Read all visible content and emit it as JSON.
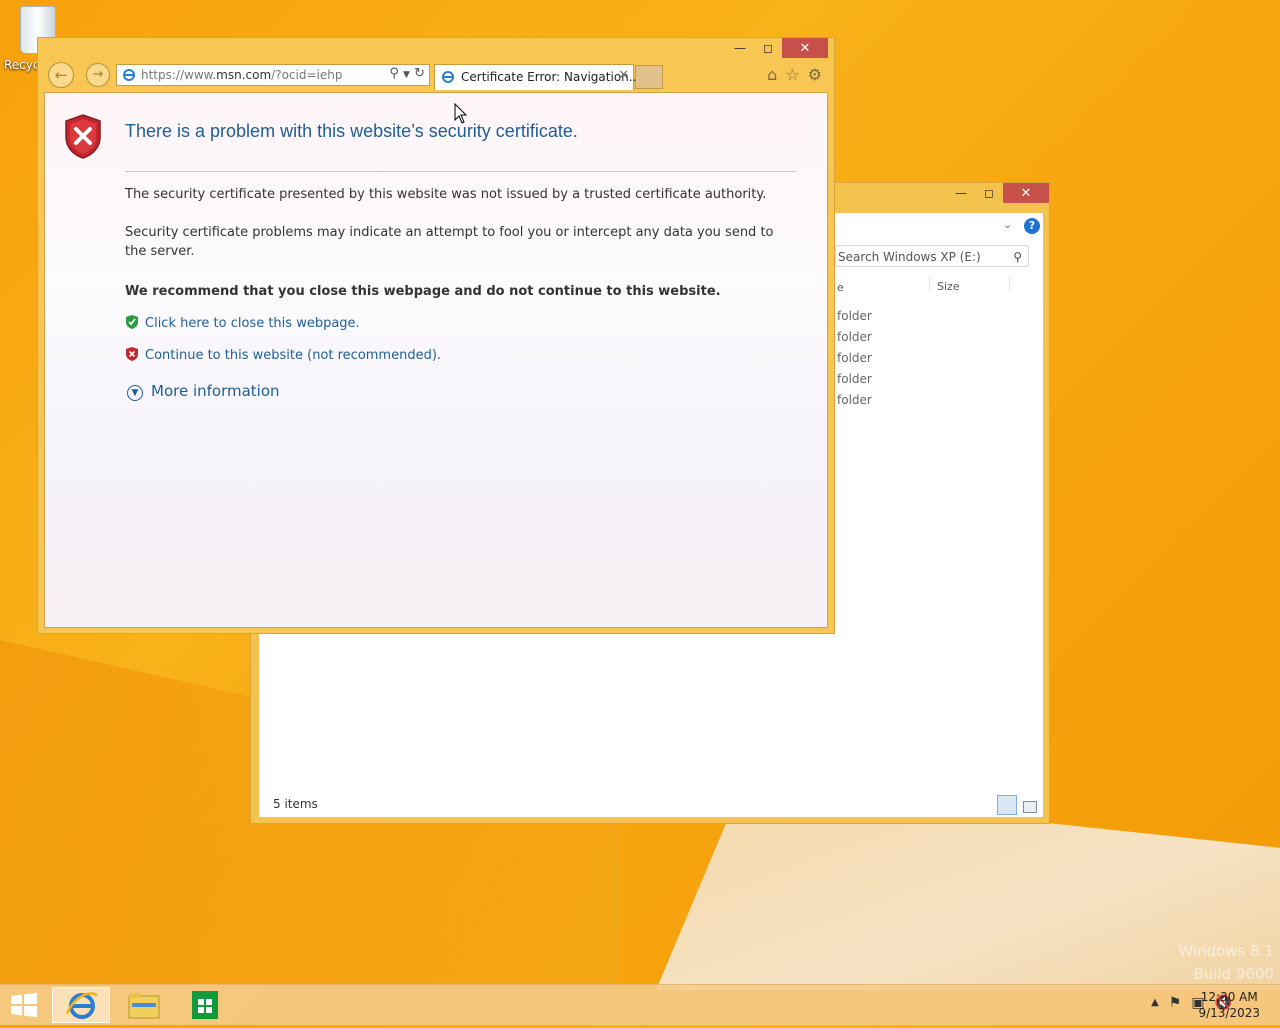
{
  "desktop": {
    "recycle_label": "Recyc",
    "watermark_line1": "Windows 8.1",
    "watermark_line2": "Build 9600"
  },
  "explorer": {
    "search_placeholder": "Search Windows XP (E:)",
    "col_e": "e",
    "col_size": "Size",
    "rows": [
      "folder",
      "folder",
      "folder",
      "folder",
      "folder"
    ],
    "status": "5 items"
  },
  "ie": {
    "url_prefix": "https://www.",
    "url_domain": "msn.com",
    "url_suffix": "/?ocid=iehp",
    "tab_title": "Certificate Error: Navigation...",
    "heading": "There is a problem with this website’s security certificate.",
    "p1": "The security certificate presented by this website was not issued by a trusted certificate authority.",
    "p2": "Security certificate problems may indicate an attempt to fool you or intercept any data you send to the server.",
    "recommend": "We recommend that you close this webpage and do not continue to this website.",
    "link_close": "Click here to close this webpage.",
    "link_continue": "Continue to this website (not recommended).",
    "more_info": "More information"
  },
  "taskbar": {
    "time": "12:30 AM",
    "date": "9/13/2023"
  },
  "colors": {
    "link": "#1f5e94",
    "close_btn": "#c7514a"
  }
}
